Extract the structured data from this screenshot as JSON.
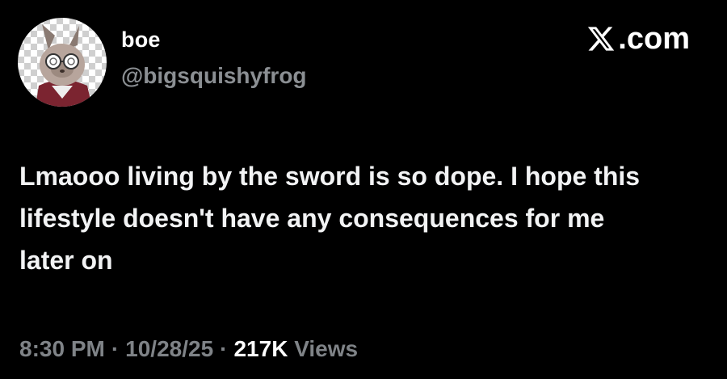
{
  "author": {
    "display_name": "boe",
    "handle": "@bigsquishyfrog",
    "avatar_icon": "cartoon-rabbit-with-glasses-avatar"
  },
  "brand": {
    "icon": "x-logo-icon",
    "label": ".com"
  },
  "tweet": {
    "text": "Lmaooo living by the sword is so dope. I hope this lifestyle doesn't have any consequences for me later on"
  },
  "meta": {
    "time": "8:30 PM",
    "separator": "·",
    "date": "10/28/25",
    "views_count": "217K",
    "views_label": "Views"
  },
  "colors": {
    "background": "#000000",
    "primary_text": "#ffffff",
    "secondary_text": "#7f8387"
  }
}
